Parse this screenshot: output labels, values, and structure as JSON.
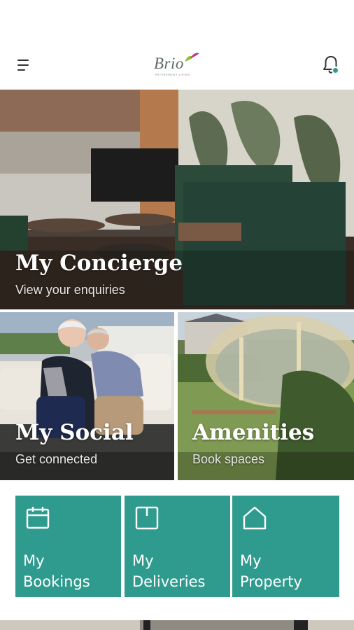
{
  "header": {
    "logo_text": "Brio",
    "logo_subtext": "RETIREMENT LIVING",
    "accent_color": "#2f9b8f",
    "left_icon": "hamburger-menu-icon",
    "right_icon": "bell-icon"
  },
  "tiles": {
    "concierge": {
      "title": "My Concierge",
      "subtitle": "View your enquiries"
    },
    "social": {
      "title": "My Social",
      "subtitle": "Get connected"
    },
    "amenities": {
      "title": "Amenities",
      "subtitle": "Book spaces"
    }
  },
  "quick_links": [
    {
      "line1": "My",
      "line2": "Bookings",
      "icon": "calendar-icon"
    },
    {
      "line1": "My",
      "line2": "Deliveries",
      "icon": "package-icon"
    },
    {
      "line1": "My",
      "line2": "Property",
      "icon": "house-icon"
    }
  ],
  "theme": {
    "tile_color": "#2f9b8f"
  }
}
